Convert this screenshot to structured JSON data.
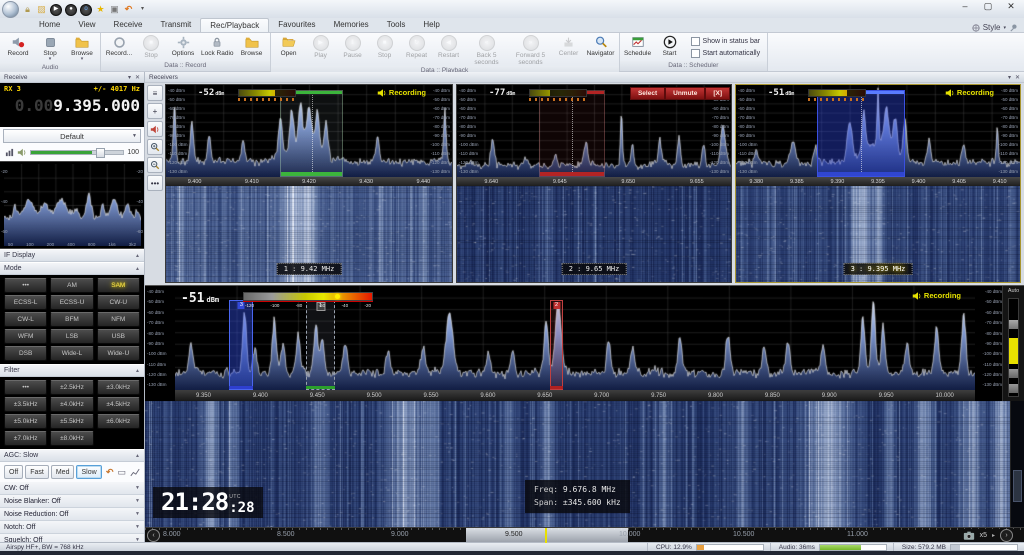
{
  "window": {
    "style_label": "Style",
    "controls": [
      "minimize",
      "maximize",
      "close"
    ]
  },
  "ribbon": {
    "tabs": [
      "Home",
      "View",
      "Receive",
      "Transmit",
      "Rec/Playback",
      "Favourites",
      "Memories",
      "Tools",
      "Help"
    ],
    "active_tab": "Rec/Playback",
    "groups": [
      {
        "label": "Audio",
        "buttons": [
          "Record",
          "Stop",
          "Browse"
        ]
      },
      {
        "label": "Data :: Record",
        "buttons": [
          "Record...",
          "Stop",
          "Options",
          "Lock Radio",
          "Browse"
        ]
      },
      {
        "label": "Data :: Playback",
        "buttons": [
          "Open",
          "Play",
          "Pause",
          "Stop",
          "Repeat",
          "Restart",
          "Back 5 seconds",
          "Forward 5 seconds",
          "Center",
          "Navigator"
        ]
      },
      {
        "label": "Data :: Scheduler",
        "buttons": [
          "Schedule",
          "Start"
        ],
        "checkboxes": [
          "Show in status bar",
          "Start automatically"
        ]
      }
    ]
  },
  "receive_panel": {
    "title": "Receive",
    "rx_label": "RX 3",
    "tuning": "+/- 4017 Hz",
    "freq_dim": "0.00",
    "freq_main": "9.395.000",
    "profile": "Default",
    "volume": "100",
    "if_display_label": "IF Display",
    "mode_label": "Mode",
    "modes": [
      "•••",
      "AM",
      "SAM",
      "ECSS-L",
      "ECSS-U",
      "CW-U",
      "CW-L",
      "BFM",
      "NFM",
      "WFM",
      "LSB",
      "USB",
      "DSB",
      "Wide-L",
      "Wide-U"
    ],
    "active_mode": "SAM",
    "filter_label": "Filter",
    "filters": [
      "•••",
      "±2.5kHz",
      "±3.0kHz",
      "±3.5kHz",
      "±4.0kHz",
      "±4.5kHz",
      "±5.0kHz",
      "±5.5kHz",
      "±6.0kHz",
      "±7.0kHz",
      "±8.0kHz"
    ],
    "agc_label": "AGC: Slow",
    "agc_buttons": [
      "Off",
      "Fast",
      "Med",
      "Slow"
    ],
    "active_agc": "Slow",
    "sections": [
      "CW: Off",
      "Noise Blanker: Off",
      "Noise Reduction: Off",
      "Notch: Off",
      "Squelch: Off"
    ],
    "if_spectrum": {
      "y_ticks": [
        "-20",
        "-40",
        "-60"
      ],
      "x_ticks": [
        "50",
        "100",
        "200",
        "400",
        "800",
        "1k6",
        "3k2"
      ]
    }
  },
  "receivers_panel": {
    "title": "Receivers",
    "y_ticks": [
      "-40 dBm",
      "-50 dBm",
      "-60 dBm",
      "-70 dBm",
      "-80 dBm",
      "-90 dBm",
      "-100 dBm",
      "-110 dBm",
      "-120 dBm",
      "-130 dBm"
    ],
    "receivers": [
      {
        "id": "1",
        "level": "-52",
        "unit": "dBm",
        "status": "Recording",
        "label": "1 : 9.42 MHz",
        "x_ticks": [
          "9.400",
          "9.410",
          "9.420",
          "9.430",
          "9.440"
        ]
      },
      {
        "id": "2",
        "level": "-77",
        "unit": "dBm",
        "buttons": [
          "Select",
          "Unmute",
          "[X]"
        ],
        "label": "2 : 9.65 MHz",
        "x_ticks": [
          "9.640",
          "9.645",
          "9.650",
          "9.655"
        ]
      },
      {
        "id": "3",
        "level": "-51",
        "unit": "dBm",
        "status": "Recording",
        "label": "3 : 9.395 MHz",
        "x_ticks": [
          "9.380",
          "9.385",
          "9.390",
          "9.395",
          "9.400",
          "9.405",
          "9.410"
        ]
      }
    ]
  },
  "main_spectrum": {
    "level": "-51",
    "unit": "dBm",
    "status": "Recording",
    "meter_scale": [
      "-120",
      "-100",
      "-80",
      "-60",
      "-40",
      "-20"
    ],
    "y_ticks": [
      "-40 dBm",
      "-50 dBm",
      "-60 dBm",
      "-70 dBm",
      "-80 dBm",
      "-90 dBm",
      "-100 dBm",
      "-110 dBm",
      "-120 dBm",
      "-130 dBm"
    ],
    "x_ticks": [
      "9.350",
      "9.400",
      "9.450",
      "9.500",
      "9.550",
      "9.600",
      "9.650",
      "9.700",
      "9.750",
      "9.800",
      "9.850",
      "9.900",
      "9.950",
      "10.000"
    ],
    "auto_label": "Auto",
    "markers": [
      {
        "id": "3"
      },
      {
        "id": "1"
      },
      {
        "id": "2"
      }
    ]
  },
  "waterfall": {
    "time_hm": "21:28",
    "time_s": ":28",
    "tz": "UTC",
    "freq_label": "Freq:",
    "freq_value": "9.676.8 MHz",
    "span_label": "Span:",
    "span_value": "±345.600 kHz"
  },
  "nav_bar": {
    "ticks": [
      "8.000",
      "8.500",
      "9.000",
      "9.500",
      "10.000",
      "10.500",
      "11.000"
    ],
    "zoom_label": "x5"
  },
  "status_bar": {
    "device": "Airspy HF+, BW = 768 kHz",
    "cpu": "CPU: 12.9%",
    "audio": "Audio: 36ms",
    "size": "Size: 579.2 MB"
  },
  "icons": [
    "app-orb-icon",
    "record-icon",
    "stop-icon",
    "folder-icon",
    "gear-icon",
    "lock-icon",
    "play-icon",
    "pause-icon",
    "repeat-icon",
    "restart-icon",
    "back5-icon",
    "forward5-icon",
    "center-icon",
    "magnifier-icon",
    "schedule-icon",
    "start-icon",
    "speaker-icon",
    "mute-icon",
    "menu-icon",
    "add-icon",
    "zoom-in-icon",
    "zoom-out-icon",
    "more-icon",
    "camera-icon",
    "undo-icon",
    "chevron-down-icon",
    "close-icon",
    "minimize-icon",
    "maximize-icon",
    "pin-icon",
    "star-icon",
    "bars-icon"
  ]
}
